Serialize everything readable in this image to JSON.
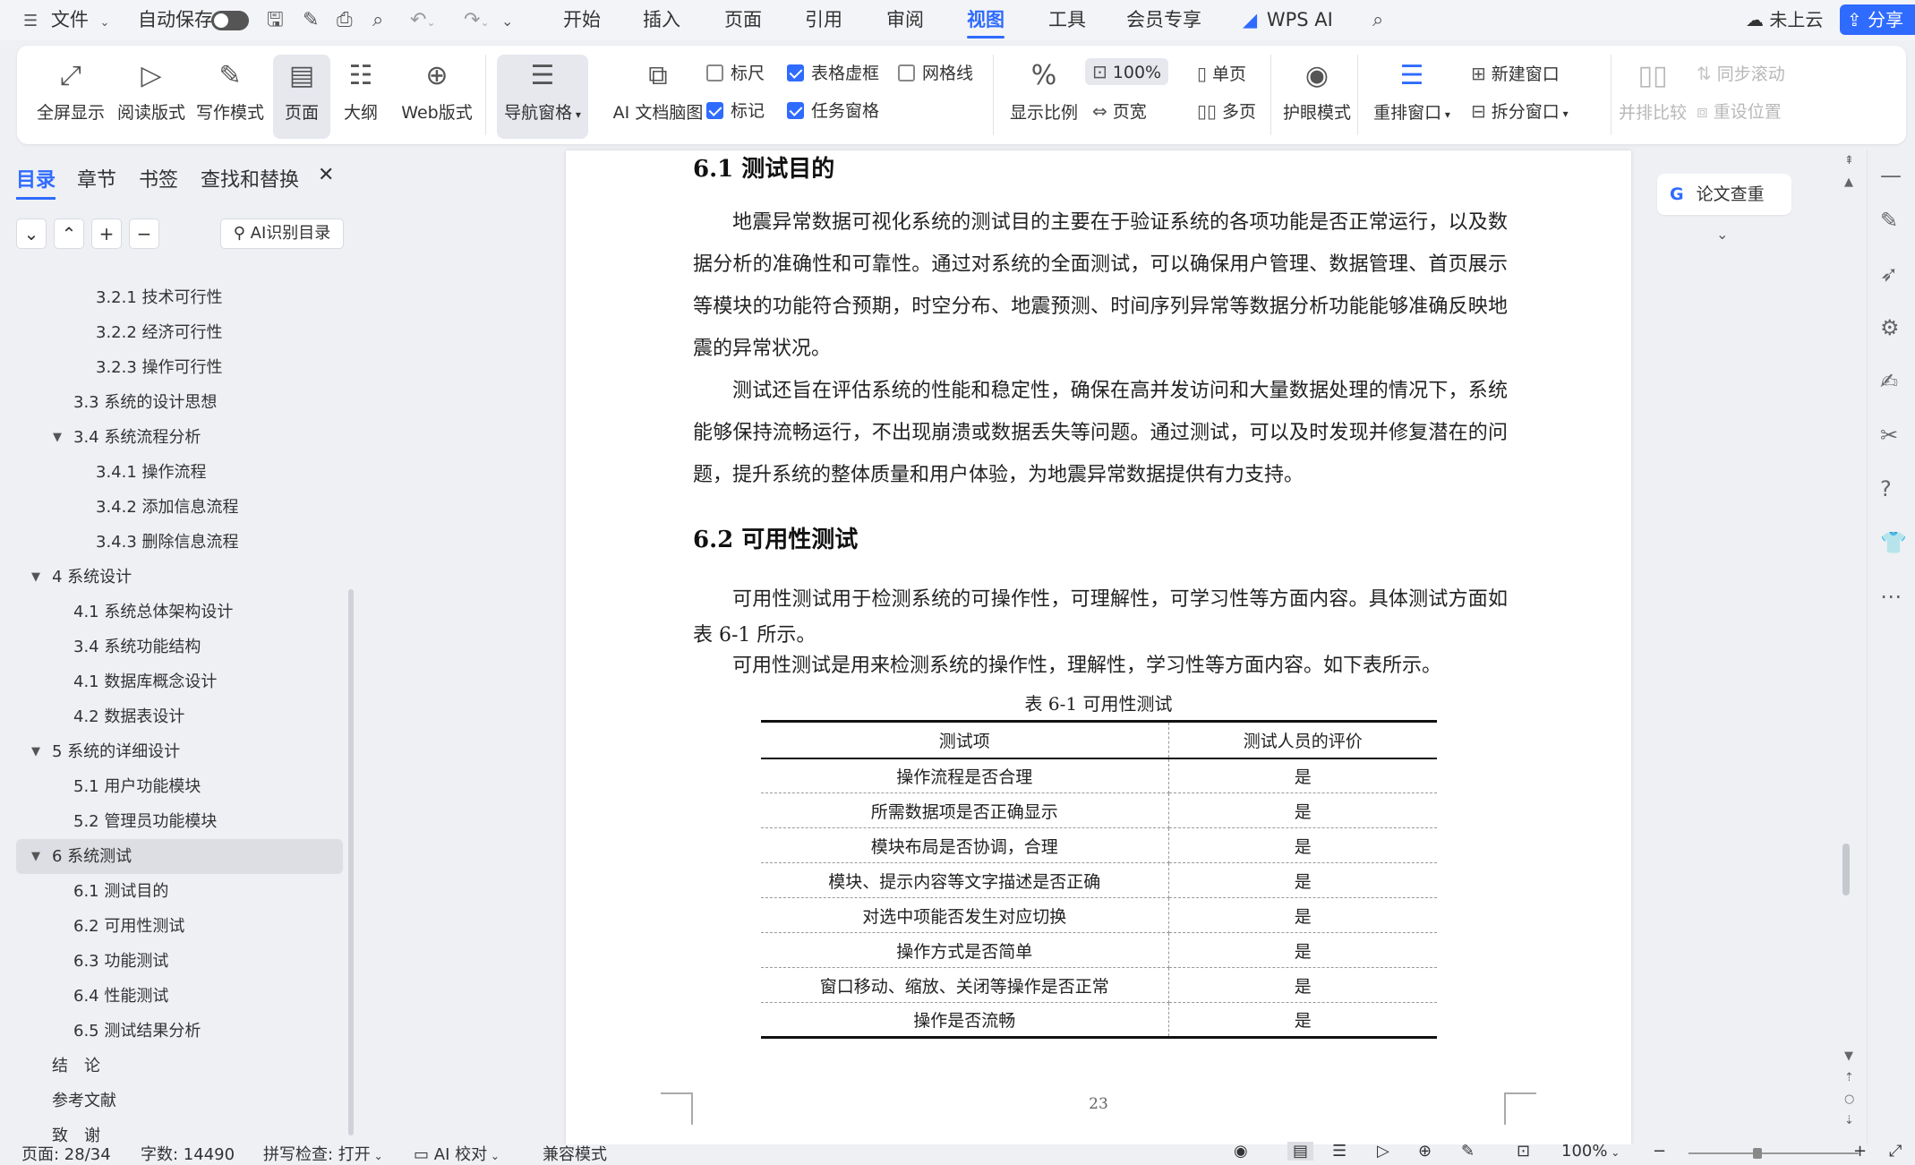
{
  "menubar": {
    "file": "文件",
    "autosave": "自动保存",
    "tabs": [
      "开始",
      "插入",
      "页面",
      "引用",
      "审阅",
      "视图",
      "工具",
      "会员专享"
    ],
    "active_tab": "视图",
    "wps_ai": "WPS AI",
    "cloud": "未上云",
    "share": "分享"
  },
  "ribbon": {
    "fullscreen": "全屏显示",
    "reading": "阅读版式",
    "writing": "写作模式",
    "page": "页面",
    "outline": "大纲",
    "web": "Web版式",
    "nav_pane": "导航窗格",
    "ai_mindmap": "AI 文档脑图",
    "ruler": "标尺",
    "table_gridlines": "表格虚框",
    "gridlines": "网格线",
    "marks": "标记",
    "task_pane": "任务窗格",
    "zoom_ratio": "显示比例",
    "zoom_100": "100%",
    "page_width": "页宽",
    "single_page": "单页",
    "multi_page": "多页",
    "eye_mode": "护眼模式",
    "rearrange": "重排窗口",
    "new_window": "新建窗口",
    "split_window": "拆分窗口",
    "side_by_side": "并排比较",
    "sync_scroll": "同步滚动",
    "reset_position": "重设位置"
  },
  "nav": {
    "tabs": [
      "目录",
      "章节",
      "书签",
      "查找和替换"
    ],
    "ai_toc": "AI识别目录",
    "items": [
      {
        "label": "3.2.1 技术可行性",
        "level": 3
      },
      {
        "label": "3.2.2 经济可行性",
        "level": 3
      },
      {
        "label": "3.2.3 操作可行性",
        "level": 3
      },
      {
        "label": "3.3 系统的设计思想",
        "level": 2
      },
      {
        "label": "3.4 系统流程分析",
        "level": 2,
        "expanded": true
      },
      {
        "label": "3.4.1 操作流程",
        "level": 3
      },
      {
        "label": "3.4.2 添加信息流程",
        "level": 3
      },
      {
        "label": "3.4.3 删除信息流程",
        "level": 3
      },
      {
        "label": "4 系统设计",
        "level": 1,
        "expanded": true
      },
      {
        "label": "4.1  系统总体架构设计",
        "level": 2
      },
      {
        "label": "3.4 系统功能结构",
        "level": 2
      },
      {
        "label": "4.1 数据库概念设计",
        "level": 2
      },
      {
        "label": "4.2 数据表设计",
        "level": 2
      },
      {
        "label": "5 系统的详细设计",
        "level": 1,
        "expanded": true
      },
      {
        "label": "5.1 用户功能模块",
        "level": 2
      },
      {
        "label": "5.2 管理员功能模块",
        "level": 2
      },
      {
        "label": "6 系统测试",
        "level": 1,
        "expanded": true,
        "selected": true
      },
      {
        "label": "6.1 测试目的",
        "level": 2
      },
      {
        "label": "6.2 可用性测试",
        "level": 2
      },
      {
        "label": "6.3 功能测试",
        "level": 2
      },
      {
        "label": "6.4 性能测试",
        "level": 2
      },
      {
        "label": "6.5 测试结果分析",
        "level": 2
      },
      {
        "label": "结　论",
        "level": 1
      },
      {
        "label": "参考文献",
        "level": 1
      },
      {
        "label": "致　谢",
        "level": 1
      }
    ]
  },
  "document": {
    "heading_61": "6.1 测试目的",
    "para1": "地震异常数据可视化系统的测试目的主要在于验证系统的各项功能是否正常运行，以及数据分析的准确性和可靠性。通过对系统的全面测试，可以确保用户管理、数据管理、首页展示等模块的功能符合预期，时空分布、地震预测、时间序列异常等数据分析功能能够准确反映地震的异常状况。",
    "para2": "测试还旨在评估系统的性能和稳定性，确保在高并发访问和大量数据处理的情况下，系统能够保持流畅运行，不出现崩溃或数据丢失等问题。通过测试，可以及时发现并修复潜在的问题，提升系统的整体质量和用户体验，为地震异常数据提供有力支持。",
    "heading_62": "6.2 可用性测试",
    "para3": "可用性测试用于检测系统的可操作性，可理解性，可学习性等方面内容。具体测试方面如表 6-1 所示。",
    "para4": "可用性测试是用来检测系统的操作性，理解性，学习性等方面内容。如下表所示。",
    "table_caption": "表 6-1 可用性测试",
    "table": {
      "headers": [
        "测试项",
        "测试人员的评价"
      ],
      "rows": [
        [
          "操作流程是否合理",
          "是"
        ],
        [
          "所需数据项是否正确显示",
          "是"
        ],
        [
          "模块布局是否协调，合理",
          "是"
        ],
        [
          "模块、提示内容等文字描述是否正确",
          "是"
        ],
        [
          "对选中项能否发生对应切换",
          "是"
        ],
        [
          "操作方式是否简单",
          "是"
        ],
        [
          "窗口移动、缩放、关闭等操作是否正常",
          "是"
        ],
        [
          "操作是否流畅",
          "是"
        ]
      ]
    },
    "page_number": "23"
  },
  "side": {
    "lunwen": "论文查重"
  },
  "status": {
    "page": "页面: 28/34",
    "words": "字数: 14490",
    "spell": "拼写检查: 打开",
    "ai_check": "AI 校对",
    "compat": "兼容模式",
    "zoom": "100%"
  },
  "colors": {
    "accent": "#2f6bff",
    "selected_toc": "#dcdee3"
  }
}
